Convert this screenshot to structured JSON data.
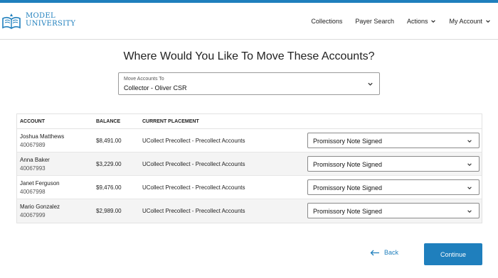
{
  "brand": {
    "line1": "MODEL",
    "line2": "UNIVERSITY",
    "accent": "#1f7fbd"
  },
  "nav": {
    "collections": "Collections",
    "payer_search": "Payer Search",
    "actions": "Actions",
    "my_account": "My Account"
  },
  "title": "Where Would You Like To Move These Accounts?",
  "move_to": {
    "label": "Move Accounts To",
    "value": "Collector - Oliver CSR"
  },
  "table": {
    "headers": {
      "account": "ACCOUNT",
      "balance": "BALANCE",
      "placement": "CURRENT PLACEMENT"
    },
    "rows": [
      {
        "name": "Joshua Matthews",
        "number": "40067989",
        "balance": "$8,491.00",
        "placement": "UCollect Precollect - Precollect Accounts",
        "status": "Promissory Note Signed"
      },
      {
        "name": "Anna Baker",
        "number": "40067993",
        "balance": "$3,229.00",
        "placement": "UCollect Precollect - Precollect Accounts",
        "status": "Promissory Note Signed"
      },
      {
        "name": "Janet Ferguson",
        "number": "40067998",
        "balance": "$9,476.00",
        "placement": "UCollect Precollect - Precollect Accounts",
        "status": "Promissory Note Signed"
      },
      {
        "name": "Mario Gonzalez",
        "number": "40067999",
        "balance": "$2,989.00",
        "placement": "UCollect Precollect - Precollect Accounts",
        "status": "Promissory Note Signed"
      }
    ]
  },
  "footer": {
    "back": "Back",
    "continue": "Continue"
  },
  "icons": {
    "logo": "book-logo-icon",
    "chevron": "chevron-down-icon",
    "back": "arrow-left-icon"
  }
}
